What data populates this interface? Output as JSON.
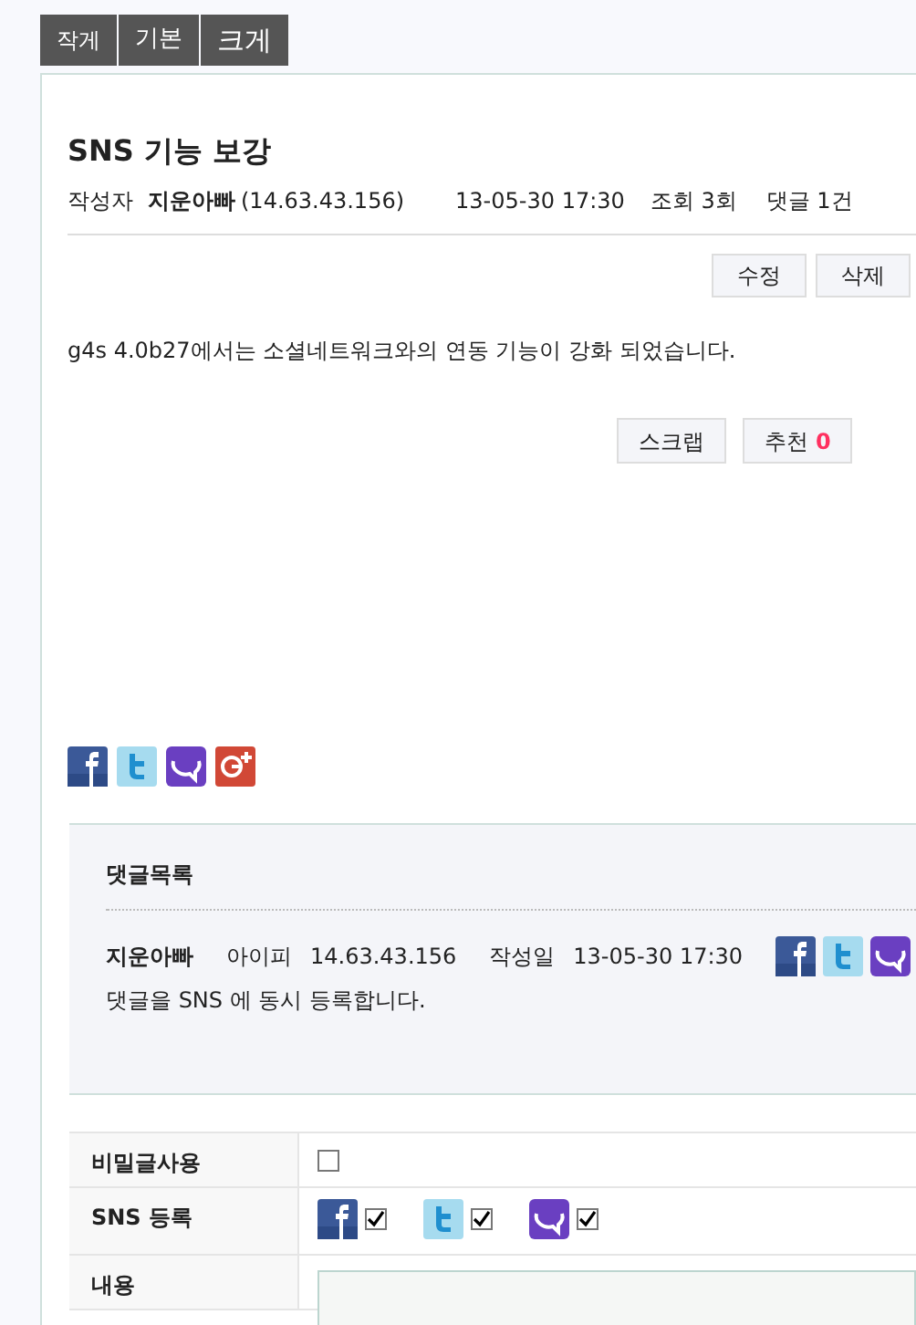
{
  "font_tabs": [
    {
      "label": "작게"
    },
    {
      "label": "기본"
    },
    {
      "label": "크게"
    }
  ],
  "post": {
    "title": "SNS 기능 보강",
    "author_label": "작성자",
    "author": "지운아빠",
    "ip": "(14.63.43.156)",
    "date": "13-05-30 17:30",
    "views": "조회 3회",
    "comments": "댓글 1건",
    "buttons": [
      "수정",
      "삭제"
    ],
    "body": "g4s 4.0b27에서는 소셜네트워크와의 연동 기능이 강화 되었습니다.",
    "scrap": "스크랩",
    "recommend": "추천",
    "recommend_count": "0"
  },
  "share_icons": [
    {
      "kind": "facebook"
    },
    {
      "kind": "twitter"
    },
    {
      "kind": "yozm"
    },
    {
      "kind": "googleplus"
    }
  ],
  "comments": {
    "heading": "댓글목록",
    "items": [
      {
        "author": "지운아빠",
        "ip_label": "아이피",
        "ip": "14.63.43.156",
        "date_label": "작성일",
        "date": "13-05-30 17:30",
        "sns": [
          {
            "kind": "facebook"
          },
          {
            "kind": "twitter"
          },
          {
            "kind": "yozm"
          }
        ],
        "text": "댓글을 SNS 에 동시 등록합니다."
      }
    ]
  },
  "form": [
    {
      "kind": "checkbox",
      "label": "비밀글사용",
      "checked": false
    },
    {
      "kind": "sns",
      "label": "SNS 등록",
      "items": [
        {
          "kind": "facebook",
          "checked": true
        },
        {
          "kind": "twitter",
          "checked": true
        },
        {
          "kind": "yozm",
          "checked": true
        }
      ]
    },
    {
      "kind": "textarea",
      "label": "내용"
    }
  ]
}
